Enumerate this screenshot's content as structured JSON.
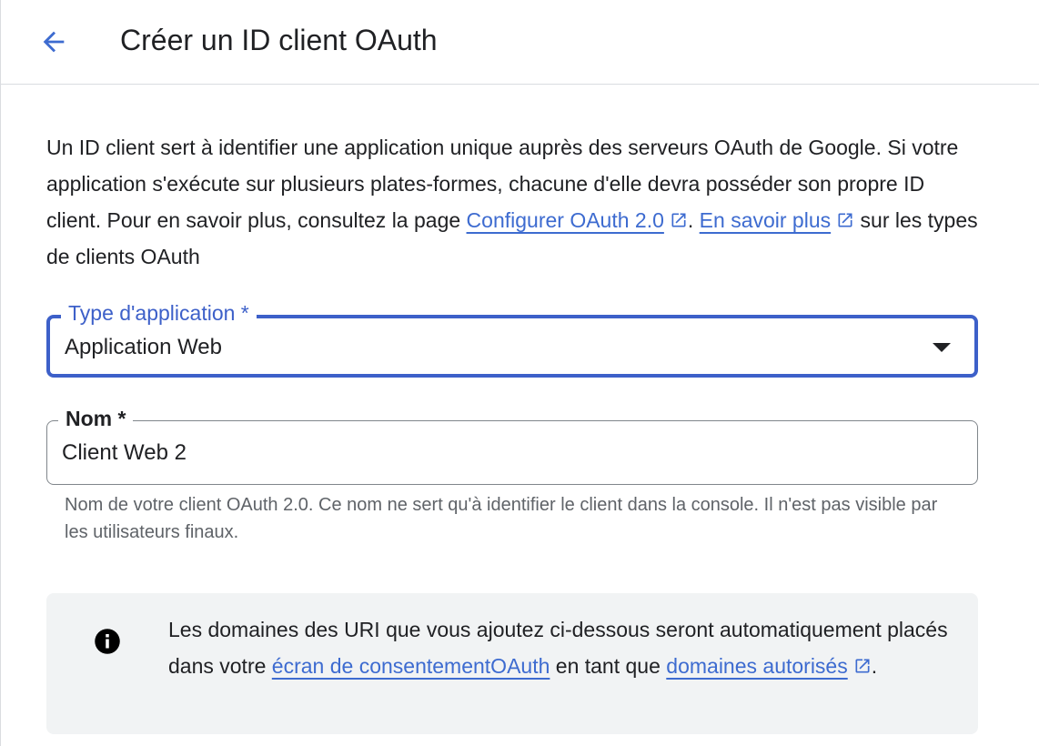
{
  "header": {
    "title": "Créer un ID client OAuth",
    "back_icon": "arrow-back-icon"
  },
  "intro": {
    "text_before_link": "Un ID client sert à identifier une application unique auprès des serveurs OAuth de Google. Si votre application s'exécute sur plusieurs plates-formes, chacune d'elle devra posséder son propre ID client. Pour en savoir plus, consultez la page ",
    "configure_link": "Configurer OAuth 2.0",
    "text_between": ". ",
    "learn_more_link": "En savoir plus",
    "text_after": " sur les types de clients OAuth"
  },
  "form": {
    "app_type": {
      "label": "Type d'application *",
      "value": "Application Web"
    },
    "name": {
      "label": "Nom *",
      "value": "Client Web 2",
      "helper": "Nom de votre client OAuth 2.0. Ce nom ne sert qu'à identifier le client dans la console. Il n'est pas visible par les utilisateurs finaux."
    }
  },
  "info_banner": {
    "icon": "info-icon",
    "text_before": "Les domaines des URI que vous ajoutez ci-dessous seront automatiquement placés dans votre ",
    "consent_link": "écran de consentementOAuth",
    "text_middle": " en tant que ",
    "domains_link": "domaines autorisés",
    "text_after": "."
  },
  "colors": {
    "accent": "#3d60c9",
    "link": "#3d6bd0",
    "text": "#202124",
    "helper": "#5f6368",
    "banner_bg": "#f1f3f4"
  }
}
